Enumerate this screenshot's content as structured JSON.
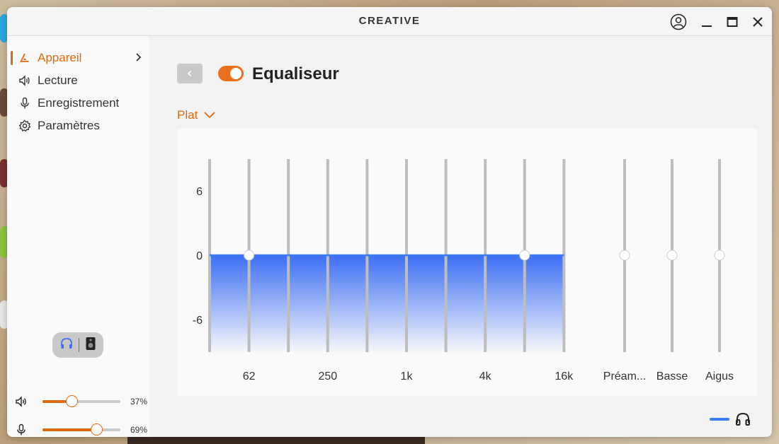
{
  "window": {
    "brand": "CREATIVE"
  },
  "sidebar": {
    "items": [
      {
        "label": "Appareil",
        "icon": "device-icon",
        "active": true
      },
      {
        "label": "Lecture",
        "icon": "speaker-icon",
        "active": false
      },
      {
        "label": "Enregistrement",
        "icon": "mic-icon",
        "active": false
      },
      {
        "label": "Paramètres",
        "icon": "gear-icon",
        "active": false
      }
    ],
    "output_toggle": {
      "options": [
        "headphones-icon",
        "speaker-box-icon"
      ],
      "selected": "headphones-icon"
    },
    "volume": {
      "label": "37%",
      "value": 0.37
    },
    "mic": {
      "label": "69%",
      "value": 0.69
    }
  },
  "equalizer": {
    "title": "Equaliseur",
    "enabled": true,
    "preset": "Plat"
  },
  "chart_data": {
    "type": "area",
    "y_ticks": [
      6,
      0,
      -6
    ],
    "ylim": [
      -9,
      9
    ],
    "bands": [
      {
        "freq": "31",
        "label": "",
        "value": 0
      },
      {
        "freq": "62",
        "label": "62",
        "value": 0
      },
      {
        "freq": "125",
        "label": "",
        "value": 0
      },
      {
        "freq": "250",
        "label": "250",
        "value": 0
      },
      {
        "freq": "500",
        "label": "",
        "value": 0
      },
      {
        "freq": "1k",
        "label": "1k",
        "value": 0
      },
      {
        "freq": "2k",
        "label": "",
        "value": 0
      },
      {
        "freq": "4k",
        "label": "4k",
        "value": 0
      },
      {
        "freq": "8k",
        "label": "",
        "value": 0
      },
      {
        "freq": "16k",
        "label": "16k",
        "value": 0
      }
    ],
    "handles_shown": [
      "62",
      "8k"
    ],
    "extra": [
      {
        "label": "Préam...",
        "value": 0
      },
      {
        "label": "Basse",
        "value": 0
      },
      {
        "label": "Aigus",
        "value": 0
      }
    ],
    "fill_color": "#3d6ff5"
  },
  "colors": {
    "accent": "#e06a10",
    "curve": "#3d7bf5"
  }
}
